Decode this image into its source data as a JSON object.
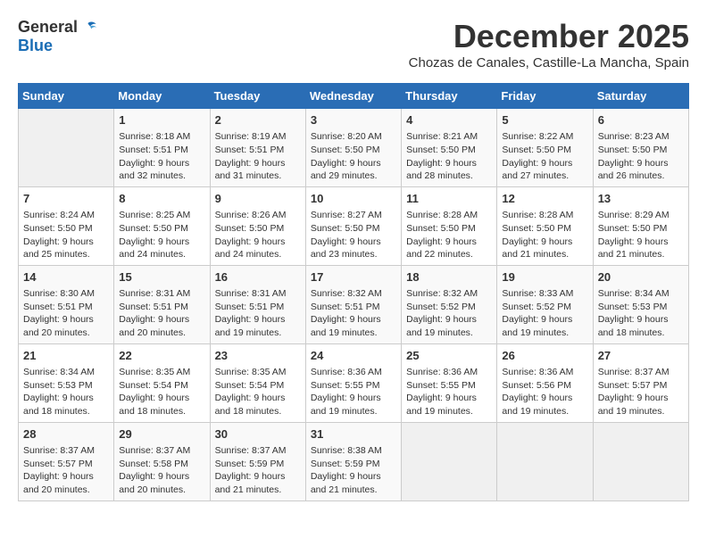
{
  "header": {
    "logo_general": "General",
    "logo_blue": "Blue",
    "month_title": "December 2025",
    "location": "Chozas de Canales, Castille-La Mancha, Spain"
  },
  "weekdays": [
    "Sunday",
    "Monday",
    "Tuesday",
    "Wednesday",
    "Thursday",
    "Friday",
    "Saturday"
  ],
  "weeks": [
    [
      {
        "day": "",
        "info": ""
      },
      {
        "day": "1",
        "info": "Sunrise: 8:18 AM\nSunset: 5:51 PM\nDaylight: 9 hours\nand 32 minutes."
      },
      {
        "day": "2",
        "info": "Sunrise: 8:19 AM\nSunset: 5:51 PM\nDaylight: 9 hours\nand 31 minutes."
      },
      {
        "day": "3",
        "info": "Sunrise: 8:20 AM\nSunset: 5:50 PM\nDaylight: 9 hours\nand 29 minutes."
      },
      {
        "day": "4",
        "info": "Sunrise: 8:21 AM\nSunset: 5:50 PM\nDaylight: 9 hours\nand 28 minutes."
      },
      {
        "day": "5",
        "info": "Sunrise: 8:22 AM\nSunset: 5:50 PM\nDaylight: 9 hours\nand 27 minutes."
      },
      {
        "day": "6",
        "info": "Sunrise: 8:23 AM\nSunset: 5:50 PM\nDaylight: 9 hours\nand 26 minutes."
      }
    ],
    [
      {
        "day": "7",
        "info": "Sunrise: 8:24 AM\nSunset: 5:50 PM\nDaylight: 9 hours\nand 25 minutes."
      },
      {
        "day": "8",
        "info": "Sunrise: 8:25 AM\nSunset: 5:50 PM\nDaylight: 9 hours\nand 24 minutes."
      },
      {
        "day": "9",
        "info": "Sunrise: 8:26 AM\nSunset: 5:50 PM\nDaylight: 9 hours\nand 24 minutes."
      },
      {
        "day": "10",
        "info": "Sunrise: 8:27 AM\nSunset: 5:50 PM\nDaylight: 9 hours\nand 23 minutes."
      },
      {
        "day": "11",
        "info": "Sunrise: 8:28 AM\nSunset: 5:50 PM\nDaylight: 9 hours\nand 22 minutes."
      },
      {
        "day": "12",
        "info": "Sunrise: 8:28 AM\nSunset: 5:50 PM\nDaylight: 9 hours\nand 21 minutes."
      },
      {
        "day": "13",
        "info": "Sunrise: 8:29 AM\nSunset: 5:50 PM\nDaylight: 9 hours\nand 21 minutes."
      }
    ],
    [
      {
        "day": "14",
        "info": "Sunrise: 8:30 AM\nSunset: 5:51 PM\nDaylight: 9 hours\nand 20 minutes."
      },
      {
        "day": "15",
        "info": "Sunrise: 8:31 AM\nSunset: 5:51 PM\nDaylight: 9 hours\nand 20 minutes."
      },
      {
        "day": "16",
        "info": "Sunrise: 8:31 AM\nSunset: 5:51 PM\nDaylight: 9 hours\nand 19 minutes."
      },
      {
        "day": "17",
        "info": "Sunrise: 8:32 AM\nSunset: 5:51 PM\nDaylight: 9 hours\nand 19 minutes."
      },
      {
        "day": "18",
        "info": "Sunrise: 8:32 AM\nSunset: 5:52 PM\nDaylight: 9 hours\nand 19 minutes."
      },
      {
        "day": "19",
        "info": "Sunrise: 8:33 AM\nSunset: 5:52 PM\nDaylight: 9 hours\nand 19 minutes."
      },
      {
        "day": "20",
        "info": "Sunrise: 8:34 AM\nSunset: 5:53 PM\nDaylight: 9 hours\nand 18 minutes."
      }
    ],
    [
      {
        "day": "21",
        "info": "Sunrise: 8:34 AM\nSunset: 5:53 PM\nDaylight: 9 hours\nand 18 minutes."
      },
      {
        "day": "22",
        "info": "Sunrise: 8:35 AM\nSunset: 5:54 PM\nDaylight: 9 hours\nand 18 minutes."
      },
      {
        "day": "23",
        "info": "Sunrise: 8:35 AM\nSunset: 5:54 PM\nDaylight: 9 hours\nand 18 minutes."
      },
      {
        "day": "24",
        "info": "Sunrise: 8:36 AM\nSunset: 5:55 PM\nDaylight: 9 hours\nand 19 minutes."
      },
      {
        "day": "25",
        "info": "Sunrise: 8:36 AM\nSunset: 5:55 PM\nDaylight: 9 hours\nand 19 minutes."
      },
      {
        "day": "26",
        "info": "Sunrise: 8:36 AM\nSunset: 5:56 PM\nDaylight: 9 hours\nand 19 minutes."
      },
      {
        "day": "27",
        "info": "Sunrise: 8:37 AM\nSunset: 5:57 PM\nDaylight: 9 hours\nand 19 minutes."
      }
    ],
    [
      {
        "day": "28",
        "info": "Sunrise: 8:37 AM\nSunset: 5:57 PM\nDaylight: 9 hours\nand 20 minutes."
      },
      {
        "day": "29",
        "info": "Sunrise: 8:37 AM\nSunset: 5:58 PM\nDaylight: 9 hours\nand 20 minutes."
      },
      {
        "day": "30",
        "info": "Sunrise: 8:37 AM\nSunset: 5:59 PM\nDaylight: 9 hours\nand 21 minutes."
      },
      {
        "day": "31",
        "info": "Sunrise: 8:38 AM\nSunset: 5:59 PM\nDaylight: 9 hours\nand 21 minutes."
      },
      {
        "day": "",
        "info": ""
      },
      {
        "day": "",
        "info": ""
      },
      {
        "day": "",
        "info": ""
      }
    ]
  ]
}
